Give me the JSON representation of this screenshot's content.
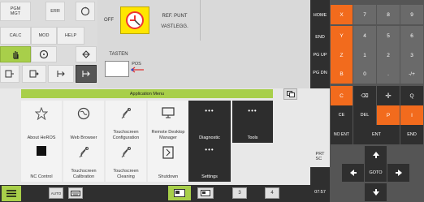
{
  "left_buttons": {
    "pgm_mgt": "PGM\nMGT",
    "err": "ERR",
    "calc": "CALC",
    "mod": "MOD",
    "help": "HELP"
  },
  "status": {
    "off": "OFF",
    "ref_line1": "REF. PUNT",
    "ref_line2": "VASTLEGG.",
    "tasten": "TASTEN",
    "pos": "POS"
  },
  "menu": {
    "title": "Application Menu",
    "tiles": [
      {
        "label": "About HeROS",
        "icon": "star-icon",
        "dark": false
      },
      {
        "label": "Web Browser",
        "icon": "globe-icon",
        "dark": false
      },
      {
        "label": "Touchscreen\nConfiguration",
        "icon": "touch-icon",
        "dark": false
      },
      {
        "label": "Remote Desktop\nManager",
        "icon": "monitor-icon",
        "dark": false
      },
      {
        "label": "Diagnostic",
        "icon": "dots-icon",
        "dark": true
      },
      {
        "label": "Tools",
        "icon": "dots-icon",
        "dark": true
      },
      {
        "label": "NC Control",
        "icon": "square-icon",
        "dark": false
      },
      {
        "label": "Touchscreen\nCalibration",
        "icon": "touch-icon",
        "dark": false
      },
      {
        "label": "Touchscreen\nCleaning",
        "icon": "touch-icon",
        "dark": false
      },
      {
        "label": "Shutdown",
        "icon": "exit-icon",
        "dark": false
      },
      {
        "label": "Settings",
        "icon": "dots-icon",
        "dark": true
      }
    ]
  },
  "right_nav": {
    "home": "HOME",
    "end": "END",
    "pgup": "PG UP",
    "pgdn": "PG DN",
    "prt_sc": "PRT\nSC",
    "time": "07:57"
  },
  "keypad": {
    "letters": [
      "X",
      "Y",
      "Z",
      "B"
    ],
    "digits": [
      [
        "7",
        "8",
        "9"
      ],
      [
        "4",
        "5",
        "6"
      ],
      [
        "1",
        "2",
        "3"
      ],
      [
        "0",
        ".",
        "-/+"
      ]
    ],
    "row5": [
      "C",
      "⌫",
      "✛",
      "Q"
    ],
    "row6": [
      "CE",
      "DEL",
      "P",
      "I"
    ],
    "row7": [
      "NO ENT",
      "ENT",
      "END"
    ],
    "goto": "GOTO"
  },
  "taskbar": {
    "auto": "AUTO",
    "page3": "3",
    "page4": "4"
  },
  "colors": {
    "orange": "#f26b1d",
    "green": "#a8cf4a",
    "dark_panel": "#2f2f2f",
    "key_gray": "#666666"
  }
}
